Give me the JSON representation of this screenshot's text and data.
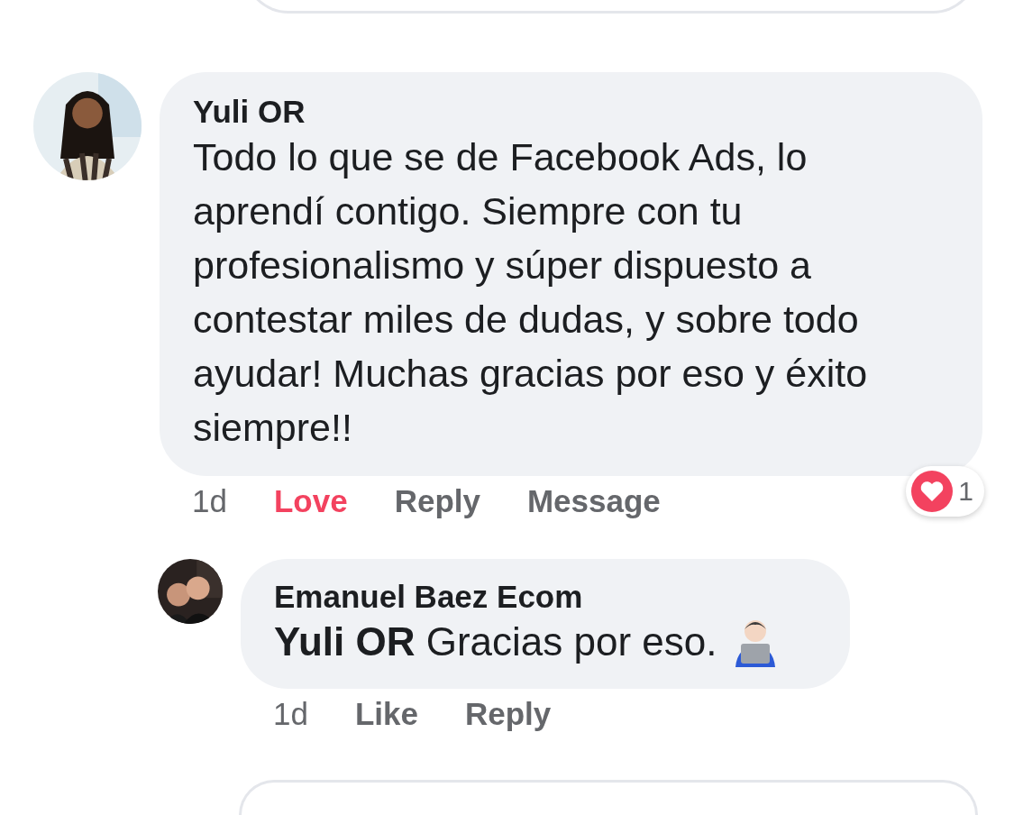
{
  "comments": [
    {
      "author": "Yuli OR",
      "text": "Todo lo que se de Facebook Ads, lo aprendí contigo. Siempre con tu profesionalismo y súper dispuesto a contestar miles de dudas, y sobre todo ayudar! Muchas gracias por eso y éxito siempre!!",
      "time": "1d",
      "actions": [
        {
          "label": "Love",
          "selected": true
        },
        {
          "label": "Reply",
          "selected": false
        },
        {
          "label": "Message",
          "selected": false
        }
      ],
      "reaction": {
        "kind": "love",
        "count": "1"
      },
      "replies": [
        {
          "author": "Emanuel Baez Ecom",
          "text": "**Yuli OR** Gracias por eso.",
          "trailing_icon": true,
          "time": "1d",
          "actions": [
            {
              "label": "Like",
              "selected": false
            },
            {
              "label": "Reply",
              "selected": false
            }
          ]
        }
      ]
    }
  ]
}
